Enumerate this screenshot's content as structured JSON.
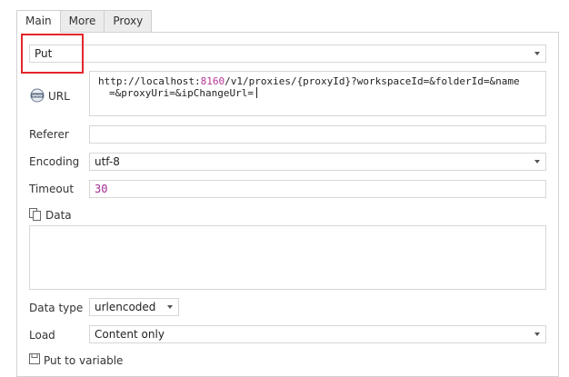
{
  "tabs": [
    {
      "label": "Main",
      "active": true
    },
    {
      "label": "More",
      "active": false
    },
    {
      "label": "Proxy",
      "active": false
    }
  ],
  "method": {
    "value": "Put"
  },
  "url": {
    "label": "URL",
    "part1": "http://localhost:",
    "port": "8160",
    "part2": "/v1/proxies/{proxyId}?workspaceId=&folderId=&name",
    "line2": "=&proxyUri=&ipChangeUrl="
  },
  "referer": {
    "label": "Referer",
    "value": ""
  },
  "encoding": {
    "label": "Encoding",
    "value": "utf-8"
  },
  "timeout": {
    "label": "Timeout",
    "value": "30"
  },
  "data": {
    "label": "Data",
    "value": ""
  },
  "data_type": {
    "label": "Data type",
    "value": "urlencoded"
  },
  "load": {
    "label": "Load",
    "value": "Content only"
  },
  "put_to_variable": {
    "label": "Put to variable"
  },
  "colors": {
    "highlight": "#e3262b",
    "number": "#a32a91"
  },
  "icons": {
    "url": "www-globe-icon",
    "data": "copy-document-icon",
    "put_to_variable": "save-icon"
  }
}
